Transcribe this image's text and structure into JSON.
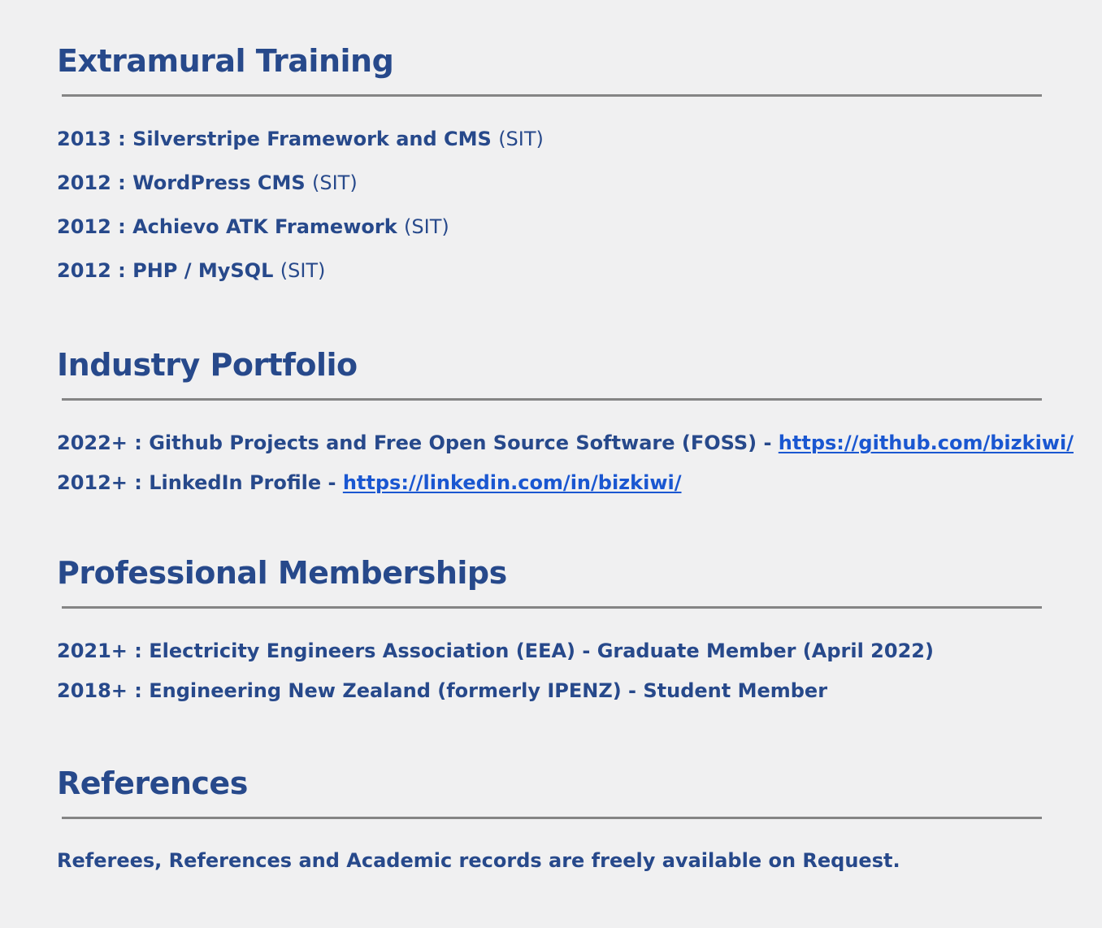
{
  "sections": {
    "training": {
      "title": "Extramural Training",
      "items": [
        {
          "label": "2013 : Silverstripe Framework and CMS",
          "provider": "(SIT)"
        },
        {
          "label": "2012 : WordPress CMS",
          "provider": "(SIT)"
        },
        {
          "label": "2012 : Achievo ATK Framework",
          "provider": "(SIT)"
        },
        {
          "label": "2012 : PHP / MySQL",
          "provider": "(SIT)"
        }
      ]
    },
    "portfolio": {
      "title": "Industry Portfolio",
      "items": [
        {
          "label": "2022+ : Github Projects and Free Open Source Software (FOSS) - ",
          "link": "https://github.com/bizkiwi/"
        },
        {
          "label": "2012+ : LinkedIn Profile - ",
          "link": "https://linkedin.com/in/bizkiwi/"
        }
      ]
    },
    "memberships": {
      "title": "Professional Memberships",
      "items": [
        {
          "label": "2021+ : Electricity Engineers Association (EEA) - Graduate Member (April 2022)"
        },
        {
          "label": "2018+ : Engineering New Zealand (formerly IPENZ) - Student Member"
        }
      ]
    },
    "references": {
      "title": "References",
      "text": "Referees, References and Academic records are freely available on Request."
    }
  },
  "colors": {
    "heading": "#27498b",
    "link": "#1a57d1",
    "rule": "#858585",
    "background": "#f0f0f1"
  }
}
